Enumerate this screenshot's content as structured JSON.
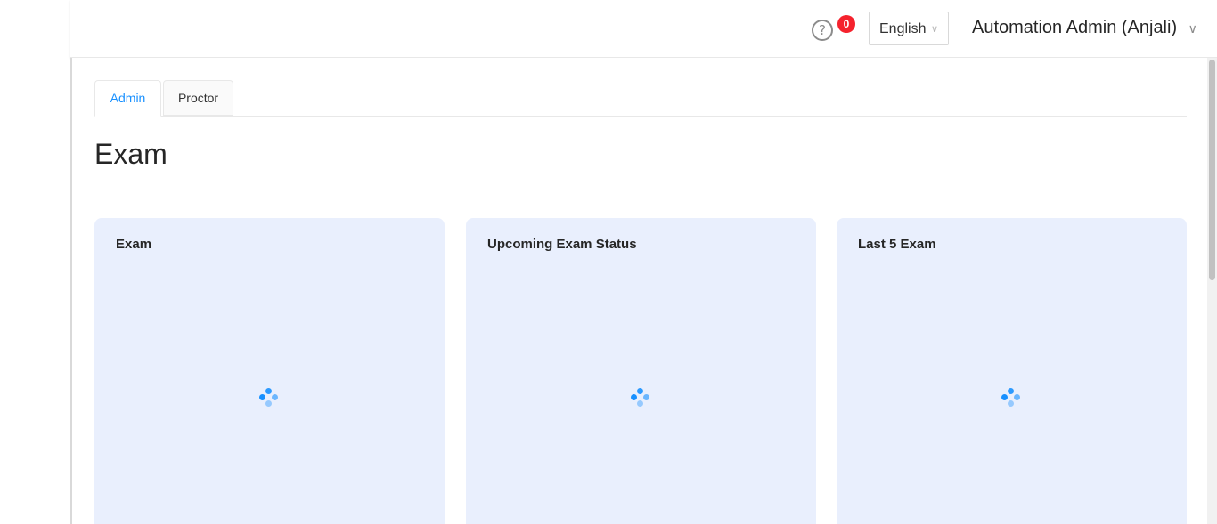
{
  "header": {
    "help_icon": "question-circle-icon",
    "help_glyph": "?",
    "notification_count": "0",
    "language": "English",
    "user_name": "Automation Admin (Anjali)",
    "dropdown_icon": "chevron-down-icon"
  },
  "tabs": [
    {
      "label": "Admin",
      "active": true
    },
    {
      "label": "Proctor",
      "active": false
    }
  ],
  "page": {
    "title": "Exam"
  },
  "cards": [
    {
      "title": "Exam",
      "state": "loading"
    },
    {
      "title": "Upcoming Exam Status",
      "state": "loading"
    },
    {
      "title": "Last 5 Exam",
      "state": "loading"
    }
  ],
  "colors": {
    "accent": "#1890ff",
    "badge": "#f5222d",
    "card_bg": "#e9effd"
  }
}
